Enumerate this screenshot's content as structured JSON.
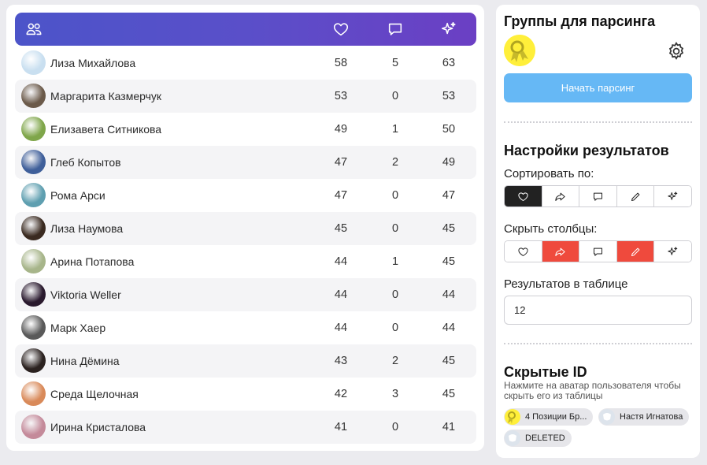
{
  "table": {
    "header_icons": [
      "users-icon",
      "heart-icon",
      "comment-icon",
      "sparkle-icon"
    ],
    "rows": [
      {
        "name": "Лиза Михайлова",
        "likes": "58",
        "comments": "5",
        "total": "63",
        "avatar_color": "#c9dff0"
      },
      {
        "name": "Маргарита Казмерчук",
        "likes": "53",
        "comments": "0",
        "total": "53",
        "avatar_color": "#6b5a4a"
      },
      {
        "name": "Елизавета Ситникова",
        "likes": "49",
        "comments": "1",
        "total": "50",
        "avatar_color": "#7fa64a"
      },
      {
        "name": "Глеб Копытов",
        "likes": "47",
        "comments": "2",
        "total": "49",
        "avatar_color": "#3f5f9a"
      },
      {
        "name": "Рома Арси",
        "likes": "47",
        "comments": "0",
        "total": "47",
        "avatar_color": "#5f9fb0"
      },
      {
        "name": "Лиза Наумова",
        "likes": "45",
        "comments": "0",
        "total": "45",
        "avatar_color": "#3a2a20"
      },
      {
        "name": "Арина Потапова",
        "likes": "44",
        "comments": "1",
        "total": "45",
        "avatar_color": "#a7b58a"
      },
      {
        "name": "Viktoria Weller",
        "likes": "44",
        "comments": "0",
        "total": "44",
        "avatar_color": "#2a1a2e"
      },
      {
        "name": "Марк Хаер",
        "likes": "44",
        "comments": "0",
        "total": "44",
        "avatar_color": "#5a5a5a"
      },
      {
        "name": "Нина Дёмина",
        "likes": "43",
        "comments": "2",
        "total": "45",
        "avatar_color": "#2b2220"
      },
      {
        "name": "Среда Щелочная",
        "likes": "42",
        "comments": "3",
        "total": "45",
        "avatar_color": "#d98a5a"
      },
      {
        "name": "Ирина Кристалова",
        "likes": "41",
        "comments": "0",
        "total": "41",
        "avatar_color": "#c48a9a"
      }
    ]
  },
  "sidebar": {
    "groups_title": "Группы для парсинга",
    "start_button": "Начать парсинг",
    "results_title": "Настройки результатов",
    "sort_label": "Сортировать по:",
    "hide_label": "Скрыть столбцы:",
    "count_label": "Результатов в таблице",
    "count_value": "12",
    "hidden_title": "Скрытые ID",
    "hidden_hint": "Нажмите на аватар пользователя чтобы скрыть его из таблицы",
    "hidden_chips": [
      "4 Позиции Бр...",
      "Настя Игнатова",
      "DELETED"
    ]
  },
  "colors": {
    "header_gradient_start": "#4c54c9",
    "header_gradient_end": "#6b3fc4",
    "start_button": "#66b8f5",
    "sort_active": "#222222",
    "hide_active": "#ef4a3d",
    "group_avatar": "#ffef3a"
  }
}
